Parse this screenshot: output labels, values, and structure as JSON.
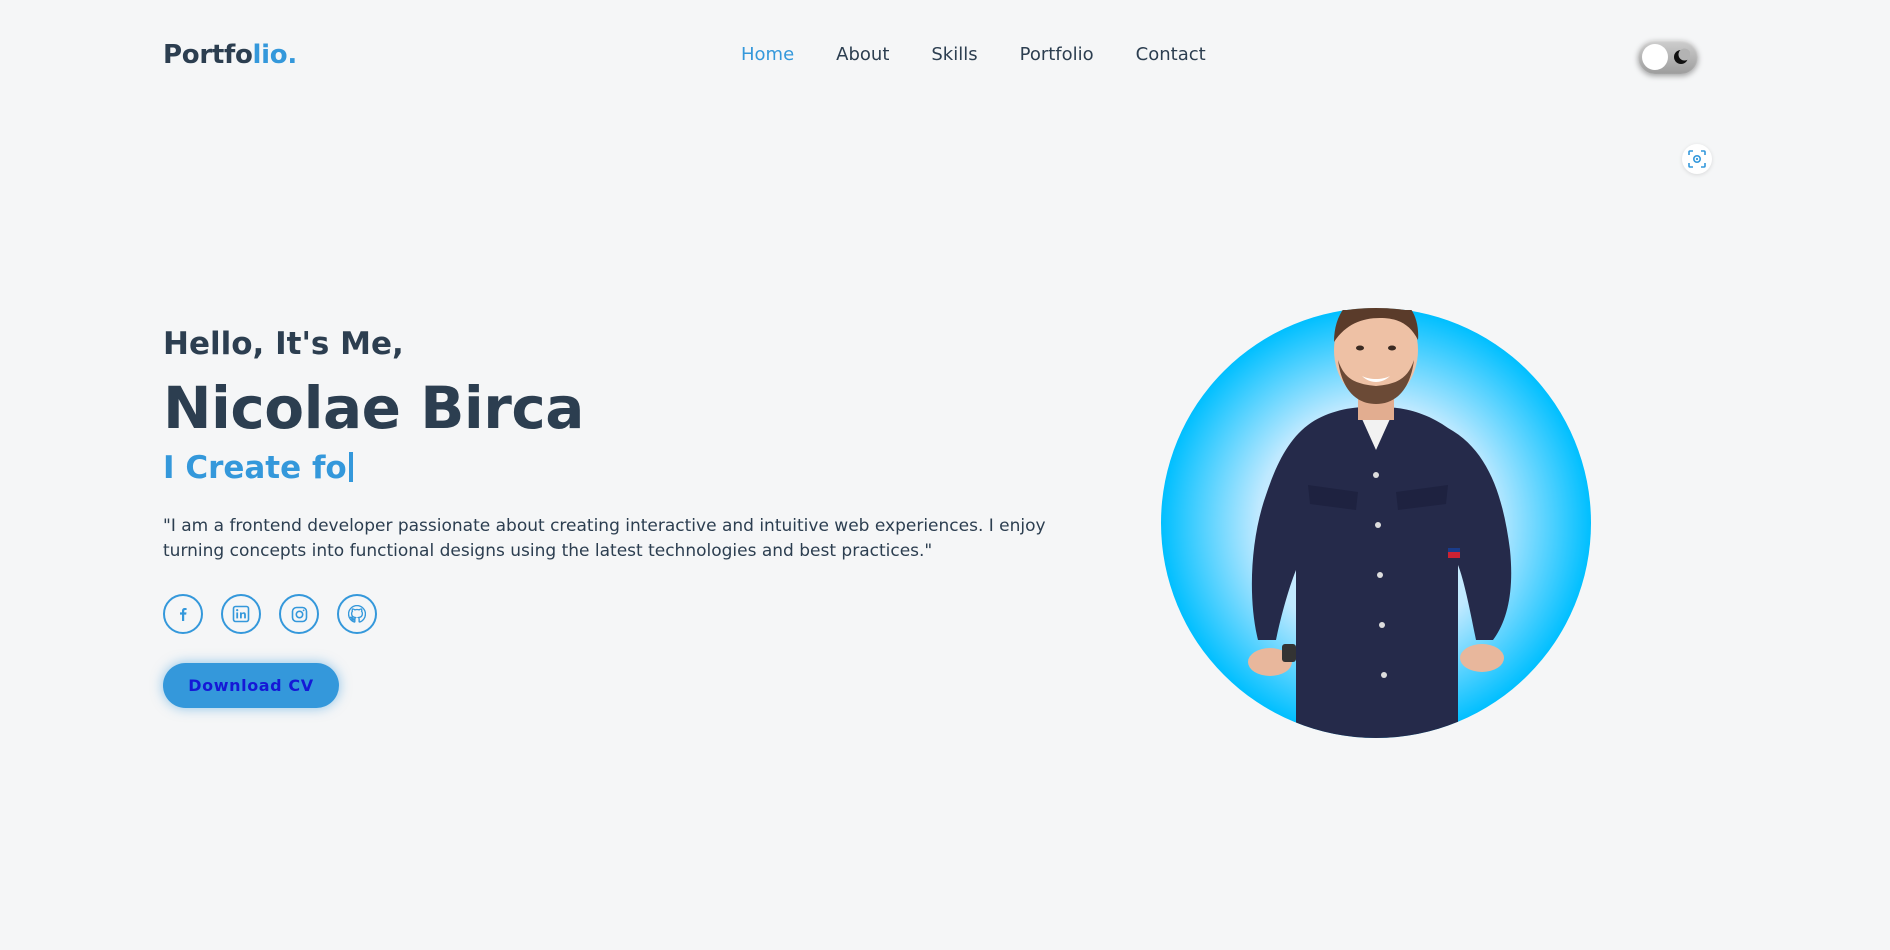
{
  "header": {
    "logo_main": "Portfo",
    "logo_accent": "lio.",
    "nav": [
      {
        "label": "Home",
        "active": true
      },
      {
        "label": "About",
        "active": false
      },
      {
        "label": "Skills",
        "active": false
      },
      {
        "label": "Portfolio",
        "active": false
      },
      {
        "label": "Contact",
        "active": false
      }
    ],
    "theme_toggle": {
      "icon": "moon-icon",
      "state": "light"
    }
  },
  "hero": {
    "greeting": "Hello, It's Me,",
    "name": "Nicolae Birca",
    "typed_text": "I Create fo",
    "bio": "\"I am a frontend developer passionate about creating interactive and intuitive web experiences. I enjoy turning concepts into functional designs using the latest technologies and best practices.\"",
    "socials": [
      "facebook-icon",
      "linkedin-icon",
      "instagram-icon",
      "github-icon"
    ],
    "cta_label": "Download CV"
  },
  "colors": {
    "accent": "#3498db",
    "text": "#2c3e50",
    "background": "#f5f6f7",
    "cta_text": "#1518d6",
    "portrait_ring": "#00bfff"
  }
}
